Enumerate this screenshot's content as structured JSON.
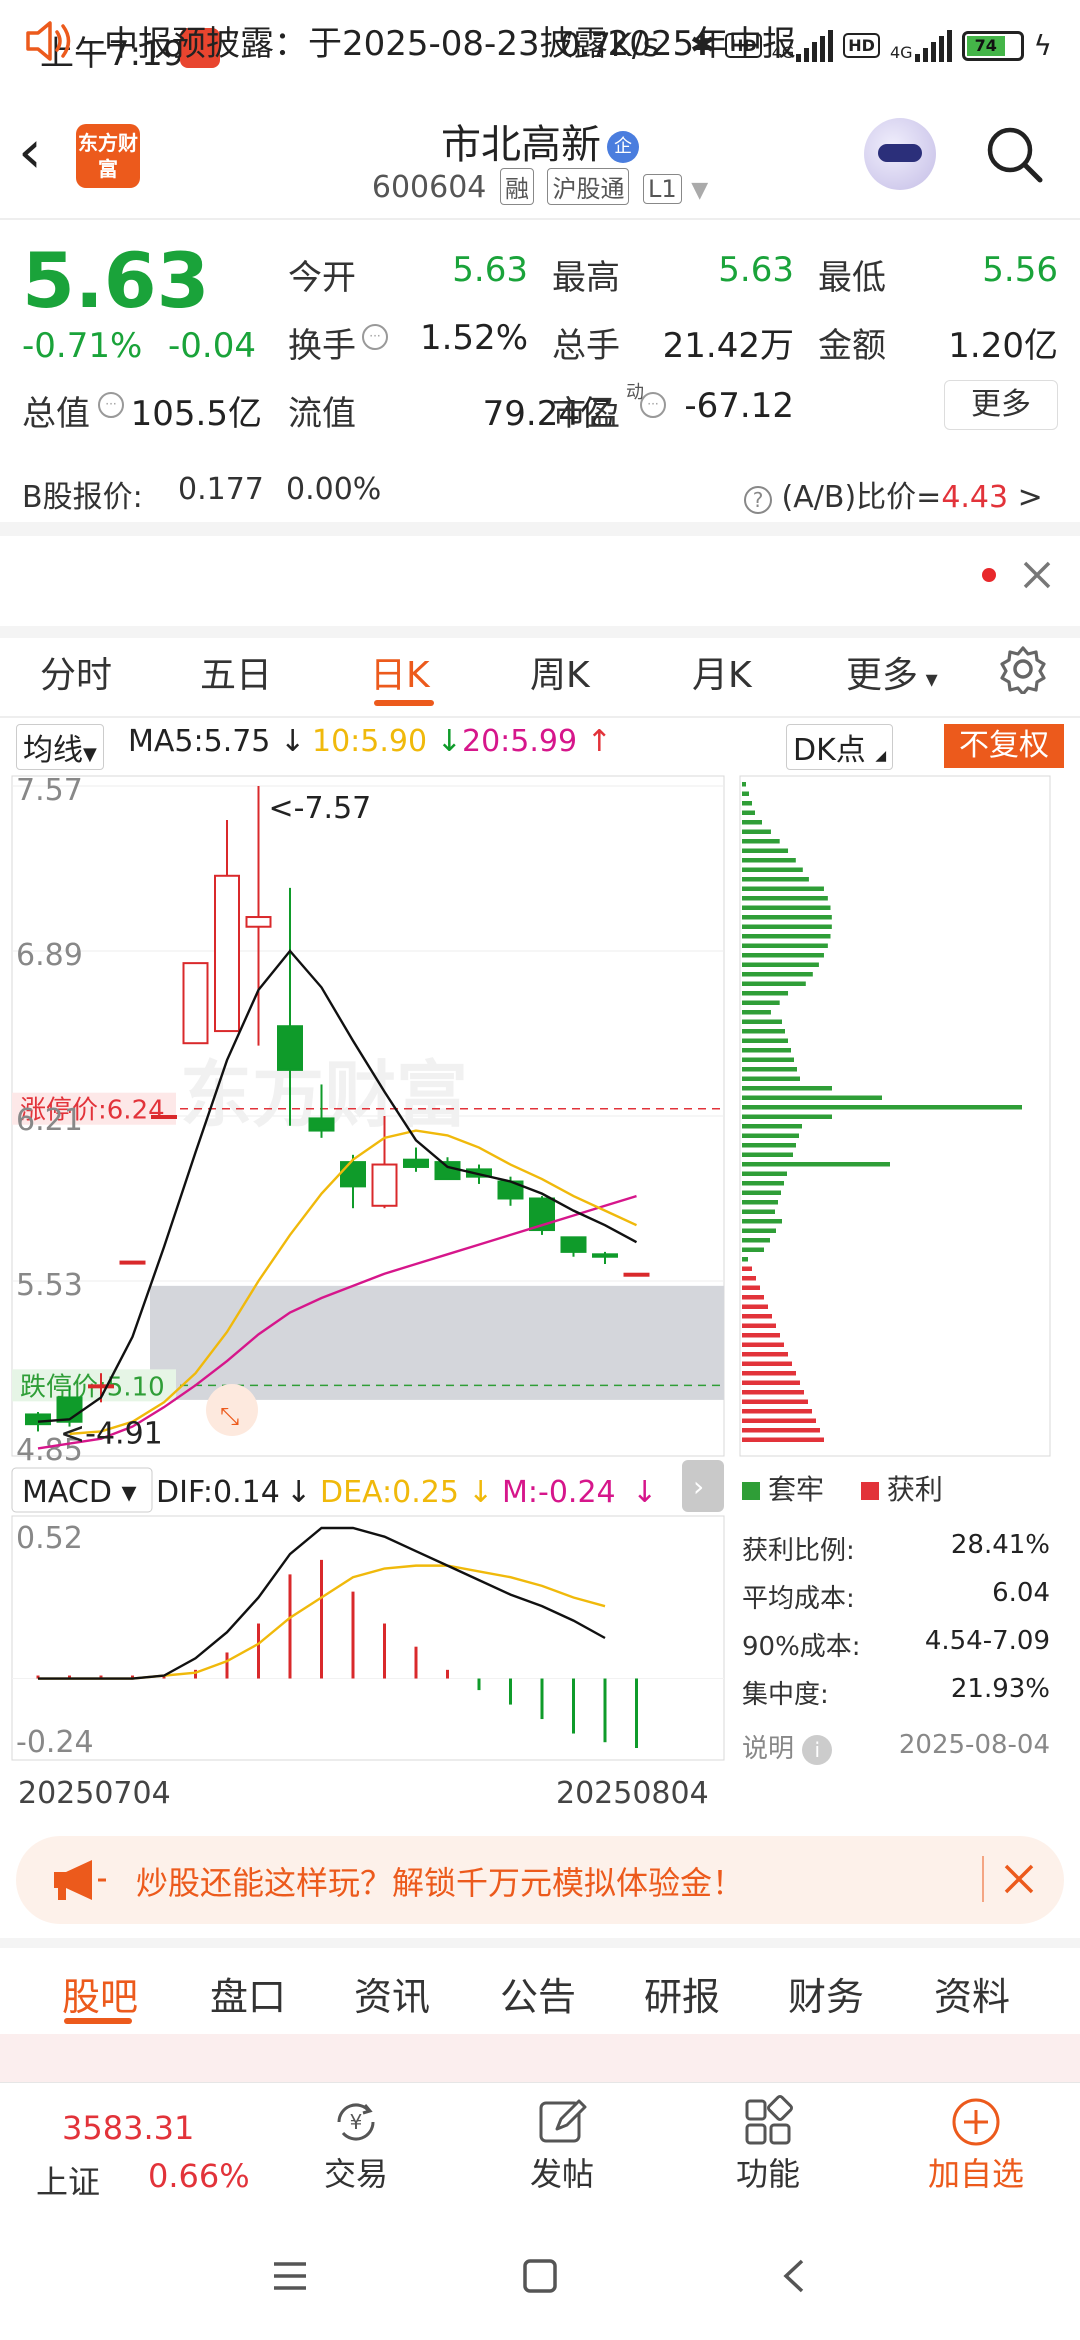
{
  "status": {
    "time": "上午7:19",
    "net_speed": "0.7K/s",
    "net1": "4G",
    "net2": "4G",
    "hd": "HD",
    "battery": "74"
  },
  "header": {
    "logo_text": "东方财富",
    "stock_name": "市北高新",
    "qi_badge": "企",
    "code": "600604",
    "tags": [
      "融",
      "沪股通",
      "L1"
    ]
  },
  "quote": {
    "price": "5.63",
    "change_pct": "-0.71%",
    "change_abs": "-0.04",
    "fields": [
      {
        "label": "今开",
        "value": "5.63",
        "green": true
      },
      {
        "label": "最高",
        "value": "5.63",
        "green": true
      },
      {
        "label": "最低",
        "value": "5.56",
        "green": true
      },
      {
        "label": "换手",
        "value": "1.52%",
        "green": false
      },
      {
        "label": "总手",
        "value": "21.42万",
        "green": false
      },
      {
        "label": "金额",
        "value": "1.20亿",
        "green": false
      },
      {
        "label": "总值",
        "value": "105.5亿",
        "green": false
      },
      {
        "label": "流值",
        "value": "79.24亿",
        "green": false
      },
      {
        "label": "市盈",
        "value": "-67.12",
        "green": false
      }
    ],
    "pe_sup": "动",
    "more": "更多",
    "b_label": "B股报价:",
    "b_price": "0.177",
    "b_pct": "0.00%",
    "ab_label": "(A/B)比价=",
    "ab_value": "4.43",
    "ab_arrow": ">"
  },
  "notice": {
    "text": "中报预披露：于2025-08-23披露2025年中报"
  },
  "ktabs": {
    "items": [
      "分时",
      "五日",
      "日K",
      "周K",
      "月K",
      "更多"
    ],
    "active": 2
  },
  "ma": {
    "type": "均线",
    "ma5": "MA5:5.75",
    "ma10": "10:5.90",
    "ma20": "20:5.99",
    "dk": "DK点",
    "fq": "不复权",
    "colors": {
      "ma5": "#111111",
      "ma10": "#f0b90b",
      "ma20": "#d6168b",
      "up": "#d9292b",
      "down": "#0f9b2a"
    }
  },
  "kline": {
    "y_labels": [
      "7.57",
      "6.89",
      "6.21",
      "5.53",
      "4.85"
    ],
    "limit_up_label": "涨停价:6.24",
    "limit_down_label": "跌停价:5.10",
    "high_marker": "<-7.57",
    "low_marker": "<-4.91",
    "watermark": "东方财富"
  },
  "chart_data": {
    "type": "candlestick",
    "y_range": [
      4.85,
      7.57
    ],
    "candles": [
      {
        "o": 4.98,
        "h": 4.99,
        "l": 4.91,
        "c": 4.94
      },
      {
        "o": 5.05,
        "h": 5.1,
        "l": 4.93,
        "c": 4.95
      },
      {
        "o": 5.1,
        "h": 5.15,
        "l": 5.03,
        "c": 5.1
      },
      {
        "o": 5.61,
        "h": 5.61,
        "l": 5.61,
        "c": 5.61
      },
      {
        "o": 6.21,
        "h": 6.21,
        "l": 6.21,
        "c": 6.21
      },
      {
        "o": 6.51,
        "h": 6.84,
        "l": 6.51,
        "c": 6.84
      },
      {
        "o": 6.56,
        "h": 7.43,
        "l": 6.56,
        "c": 7.2
      },
      {
        "o": 6.99,
        "h": 7.57,
        "l": 6.5,
        "c": 7.03
      },
      {
        "o": 6.58,
        "h": 7.15,
        "l": 6.17,
        "c": 6.4
      },
      {
        "o": 6.2,
        "h": 6.34,
        "l": 6.12,
        "c": 6.15
      },
      {
        "o": 6.02,
        "h": 6.05,
        "l": 5.83,
        "c": 5.92
      },
      {
        "o": 5.84,
        "h": 6.21,
        "l": 5.83,
        "c": 6.01
      },
      {
        "o": 6.03,
        "h": 6.08,
        "l": 5.98,
        "c": 6.0
      },
      {
        "o": 6.02,
        "h": 6.04,
        "l": 5.95,
        "c": 5.95
      },
      {
        "o": 5.99,
        "h": 6.01,
        "l": 5.93,
        "c": 5.96
      },
      {
        "o": 5.94,
        "h": 5.96,
        "l": 5.84,
        "c": 5.87
      },
      {
        "o": 5.87,
        "h": 5.88,
        "l": 5.72,
        "c": 5.74
      },
      {
        "o": 5.71,
        "h": 5.71,
        "l": 5.63,
        "c": 5.65
      },
      {
        "o": 5.64,
        "h": 5.65,
        "l": 5.6,
        "c": 5.63
      },
      {
        "o": 5.56,
        "h": 5.56,
        "l": 5.56,
        "c": 5.56
      }
    ],
    "ma5": [
      4.95,
      4.96,
      5.05,
      5.3,
      5.67,
      6.06,
      6.44,
      6.73,
      6.89,
      6.74,
      6.52,
      6.31,
      6.11,
      6.0,
      5.97,
      5.94,
      5.89,
      5.82,
      5.76,
      5.69
    ],
    "ma10": [
      4.9,
      4.91,
      4.95,
      5.03,
      5.15,
      5.32,
      5.53,
      5.72,
      5.89,
      6.03,
      6.12,
      6.15,
      6.13,
      6.08,
      6.01,
      5.95,
      5.88,
      5.82,
      5.76
    ],
    "ma20": [
      4.84,
      4.86,
      4.88,
      4.93,
      5.01,
      5.1,
      5.2,
      5.31,
      5.4,
      5.46,
      5.51,
      5.56,
      5.6,
      5.64,
      5.68,
      5.72,
      5.76,
      5.8,
      5.84,
      5.88
    ],
    "limit_up": 6.24,
    "limit_down": 5.1,
    "gray_zone": [
      5.04,
      5.51
    ],
    "macd": {
      "dif_label": "DIF:0.14",
      "dea_label": "DEA:0.25",
      "m_label": "M:-0.24",
      "y_labels": [
        "0.52",
        "-0.24"
      ],
      "y_range": [
        -0.24,
        0.52
      ],
      "dif": [
        0.0,
        0.0,
        0.0,
        0.0,
        0.01,
        0.07,
        0.16,
        0.28,
        0.43,
        0.52,
        0.52,
        0.49,
        0.44,
        0.39,
        0.34,
        0.29,
        0.25,
        0.2,
        0.14
      ],
      "dea": [
        0.0,
        0.0,
        0.0,
        0.0,
        0.01,
        0.02,
        0.06,
        0.12,
        0.21,
        0.28,
        0.35,
        0.38,
        0.39,
        0.39,
        0.37,
        0.35,
        0.32,
        0.28,
        0.25
      ],
      "m": [
        0.0,
        0.0,
        0.0,
        0.0,
        0.0,
        0.03,
        0.09,
        0.19,
        0.36,
        0.41,
        0.3,
        0.19,
        0.11,
        0.03,
        -0.04,
        -0.09,
        -0.14,
        -0.19,
        -0.22,
        -0.24
      ]
    },
    "dates": [
      "20250704",
      "20250804"
    ]
  },
  "chip": {
    "legend_trapped": "套牢",
    "legend_profit": "获利",
    "stats": [
      {
        "label": "获利比例:",
        "value": "28.41%"
      },
      {
        "label": "平均成本:",
        "value": "6.04"
      },
      {
        "label": "90%成本:",
        "value": "4.54-7.09"
      },
      {
        "label": "集中度:",
        "value": "21.93%"
      }
    ],
    "note_label": "说明",
    "date": "2025-08-04",
    "green": "#2f9e37",
    "red": "#e2333a"
  },
  "banner": {
    "text": "炒股还能这样玩？解锁千万元模拟体验金！"
  },
  "btabs": {
    "items": [
      "股吧",
      "盘口",
      "资讯",
      "公告",
      "研报",
      "财务",
      "资料"
    ],
    "active": 0
  },
  "bottom_nav": {
    "index_value": "3583.31",
    "index_name": "上证",
    "index_pct": "0.66%",
    "items": [
      "交易",
      "发帖",
      "功能",
      "加自选"
    ]
  }
}
